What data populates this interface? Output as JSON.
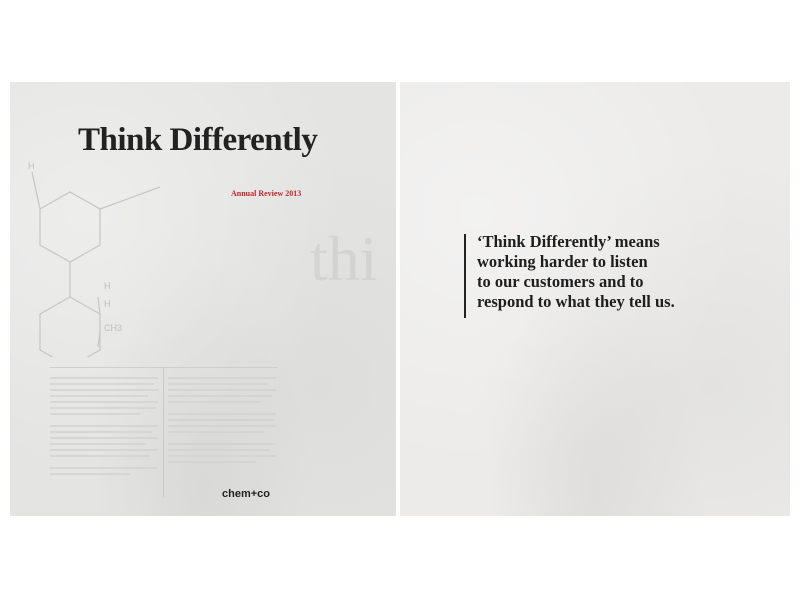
{
  "cover": {
    "title": "Think Differently",
    "subtitle": "Annual Review 2013",
    "background_word": "thi",
    "logo": "chem+co",
    "molecule_labels": [
      "H",
      "H",
      "H",
      "CH3"
    ]
  },
  "inner_page": {
    "quote_lines": [
      "‘Think Differently’ means",
      "working harder to listen",
      "to our customers and to",
      "respond to what they tell us."
    ]
  },
  "colors": {
    "accent_red": "#c0272d",
    "text_dark": "#222222",
    "page_bg": "#ebebea"
  }
}
